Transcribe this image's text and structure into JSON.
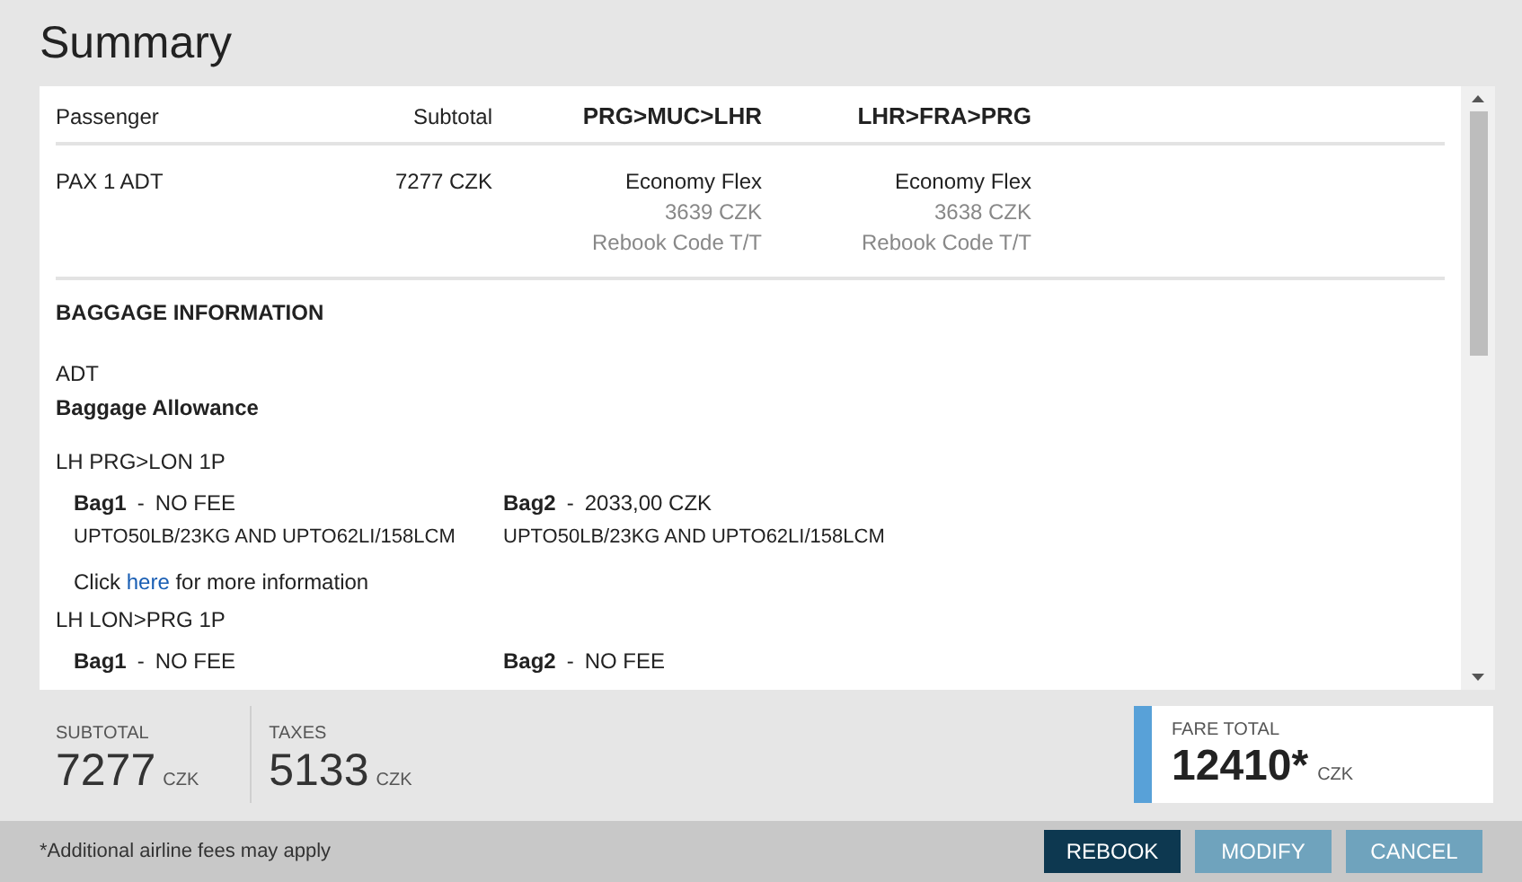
{
  "title": "Summary",
  "fare_table": {
    "columns": [
      "Passenger",
      "Subtotal",
      "PRG>MUC>LHR",
      "LHR>FRA>PRG"
    ],
    "rows": [
      {
        "passenger": "PAX 1 ADT",
        "subtotal": "7277 CZK",
        "segments": [
          {
            "fare": "Economy Flex",
            "price": "3639 CZK",
            "code": "Rebook Code T/T"
          },
          {
            "fare": "Economy Flex",
            "price": "3638 CZK",
            "code": "Rebook Code T/T"
          }
        ]
      }
    ]
  },
  "baggage": {
    "heading": "BAGGAGE INFORMATION",
    "passenger_type": "ADT",
    "subheading": "Baggage Allowance",
    "routes": [
      {
        "route": "LH PRG>LON 1P",
        "bags": [
          {
            "label": "Bag1",
            "separator": "-",
            "fee": "NO FEE",
            "limits": "UPTO50LB/23KG AND UPTO62LI/158LCM"
          },
          {
            "label": "Bag2",
            "separator": "-",
            "fee": "2033,00 CZK",
            "limits": "UPTO50LB/23KG AND UPTO62LI/158LCM"
          }
        ],
        "info": {
          "before": "Click",
          "link": "here",
          "after": "for more information"
        }
      },
      {
        "route": "LH LON>PRG 1P",
        "bags": [
          {
            "label": "Bag1",
            "separator": "-",
            "fee": "NO FEE"
          },
          {
            "label": "Bag2",
            "separator": "-",
            "fee": "NO FEE"
          }
        ]
      }
    ]
  },
  "totals": [
    {
      "label": "SUBTOTAL",
      "amount": "7277",
      "currency": "CZK"
    },
    {
      "label": "TAXES",
      "amount": "5133",
      "currency": "CZK"
    }
  ],
  "fare_total": {
    "label": "FARE TOTAL",
    "amount": "12410*",
    "currency": "CZK"
  },
  "footnote": "*Additional airline fees may apply",
  "buttons": [
    {
      "label": "REBOOK",
      "kind": "primary"
    },
    {
      "label": "MODIFY",
      "kind": "secondary"
    },
    {
      "label": "CANCEL",
      "kind": "secondary"
    }
  ]
}
